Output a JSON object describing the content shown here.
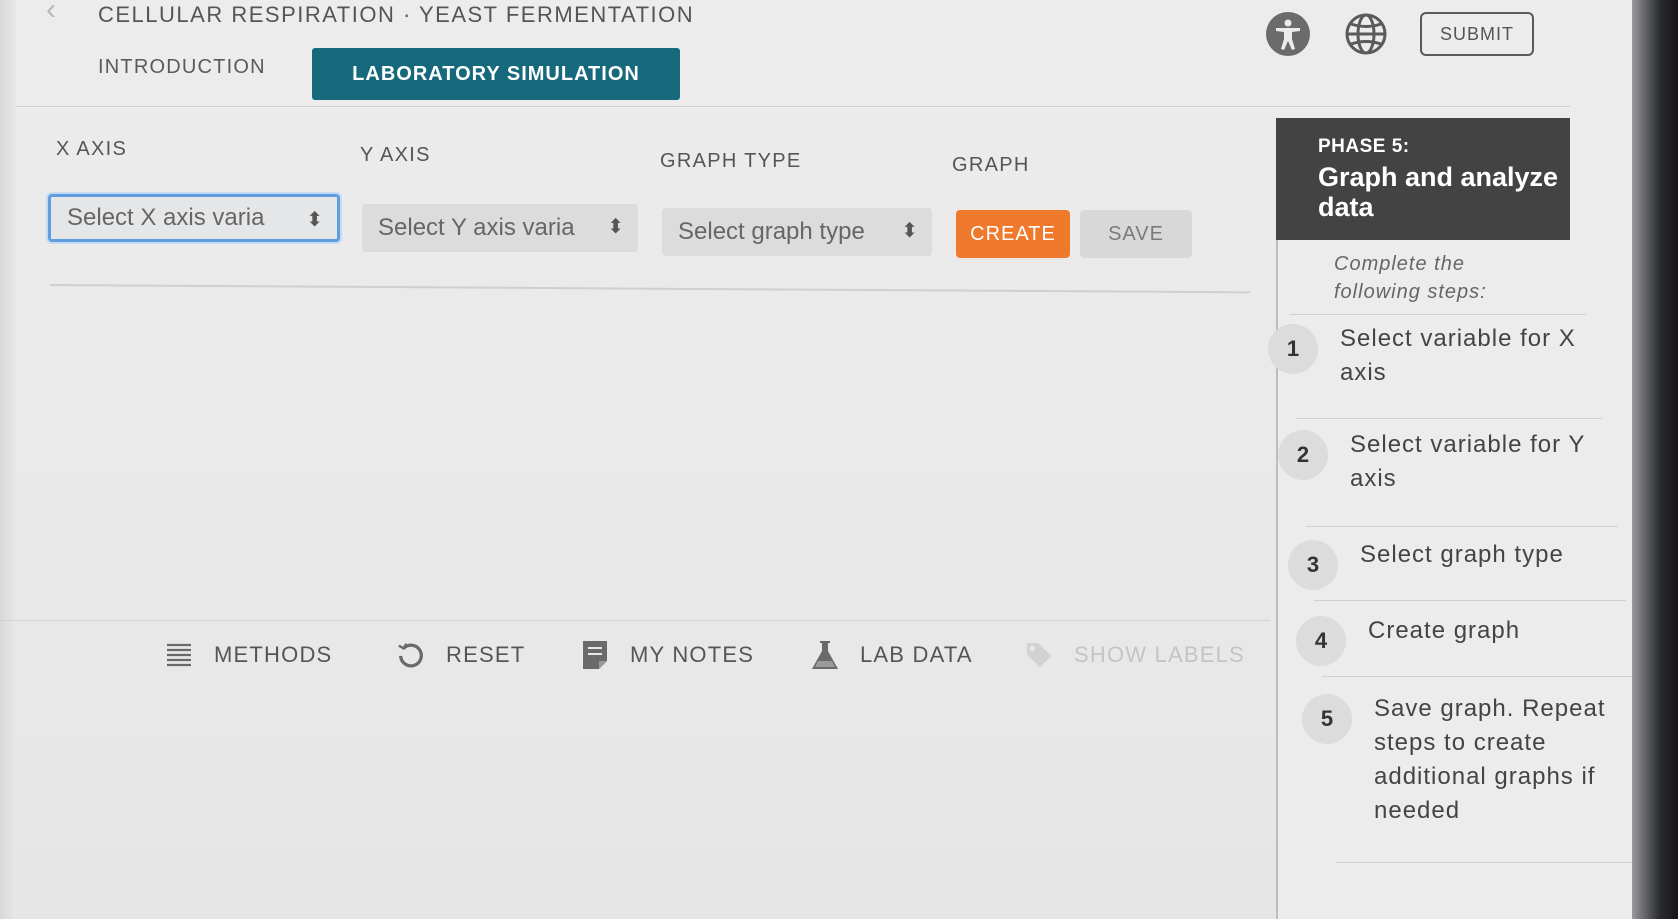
{
  "header": {
    "title": "CELLULAR RESPIRATION · YEAST FERMENTATION",
    "submit_label": "SUBMIT",
    "icons": [
      "back-chevron-icon",
      "accessibility-icon",
      "globe-icon"
    ]
  },
  "tabs": [
    {
      "label": "INTRODUCTION",
      "active": false
    },
    {
      "label": "LABORATORY SIMULATION",
      "active": true
    }
  ],
  "controls": {
    "x_axis_label": "X AXIS",
    "y_axis_label": "Y AXIS",
    "graph_type_label": "GRAPH TYPE",
    "graph_label": "GRAPH",
    "x_select": "Select X axis varia",
    "y_select": "Select Y axis varia",
    "graph_type_select": "Select graph type",
    "create_label": "CREATE",
    "save_label": "SAVE"
  },
  "toolbar": {
    "methods": "METHODS",
    "reset": "RESET",
    "my_notes": "MY NOTES",
    "lab_data": "LAB DATA",
    "show_labels": "SHOW LABELS"
  },
  "panel": {
    "phase_number": "PHASE 5:",
    "phase_title": "Graph and analyze data",
    "intro": "Complete the following steps:",
    "steps": [
      {
        "num": "1",
        "text": "Select variable for X axis"
      },
      {
        "num": "2",
        "text": "Select variable for Y axis"
      },
      {
        "num": "3",
        "text": "Select graph type"
      },
      {
        "num": "4",
        "text": "Create graph"
      },
      {
        "num": "5",
        "text": "Save graph. Repeat steps to create additional graphs if needed"
      }
    ]
  },
  "colors": {
    "tab_active": "#16697c",
    "create": "#f07a2c",
    "phase_header": "#434343",
    "focus_ring": "#5e9ee0"
  }
}
